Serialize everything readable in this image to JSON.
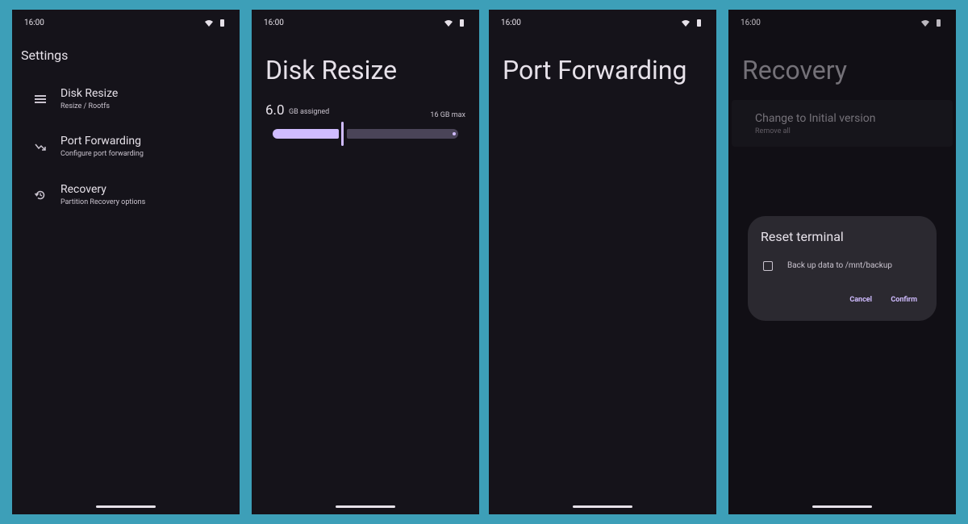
{
  "status_bar": {
    "time": "16:00"
  },
  "settings_screen": {
    "title": "Settings",
    "items": [
      {
        "label": "Disk Resize",
        "sublabel": "Resize / Rootfs",
        "icon": "storage-icon"
      },
      {
        "label": "Port Forwarding",
        "sublabel": "Configure port forwarding",
        "icon": "arrow-trending-icon"
      },
      {
        "label": "Recovery",
        "sublabel": "Partition Recovery options",
        "icon": "restore-icon"
      }
    ]
  },
  "disk_resize_screen": {
    "title": "Disk Resize",
    "value": "6.0",
    "assigned_label": "GB assigned",
    "max_label": "16 GB max",
    "slider_fraction": 0.375
  },
  "port_forwarding_screen": {
    "title": "Port Forwarding"
  },
  "recovery_screen": {
    "title": "Recovery",
    "option": {
      "label": "Change to Initial version",
      "sublabel": "Remove all"
    },
    "dialog": {
      "title": "Reset terminal",
      "checkbox_label": "Back up data to /mnt/backup",
      "checkbox_checked": false,
      "cancel_label": "Cancel",
      "confirm_label": "Confirm"
    }
  },
  "colors": {
    "background": "#3d9fb8",
    "surface": "#15131a",
    "accent": "#d0bcff",
    "dialog": "#2b2930"
  }
}
